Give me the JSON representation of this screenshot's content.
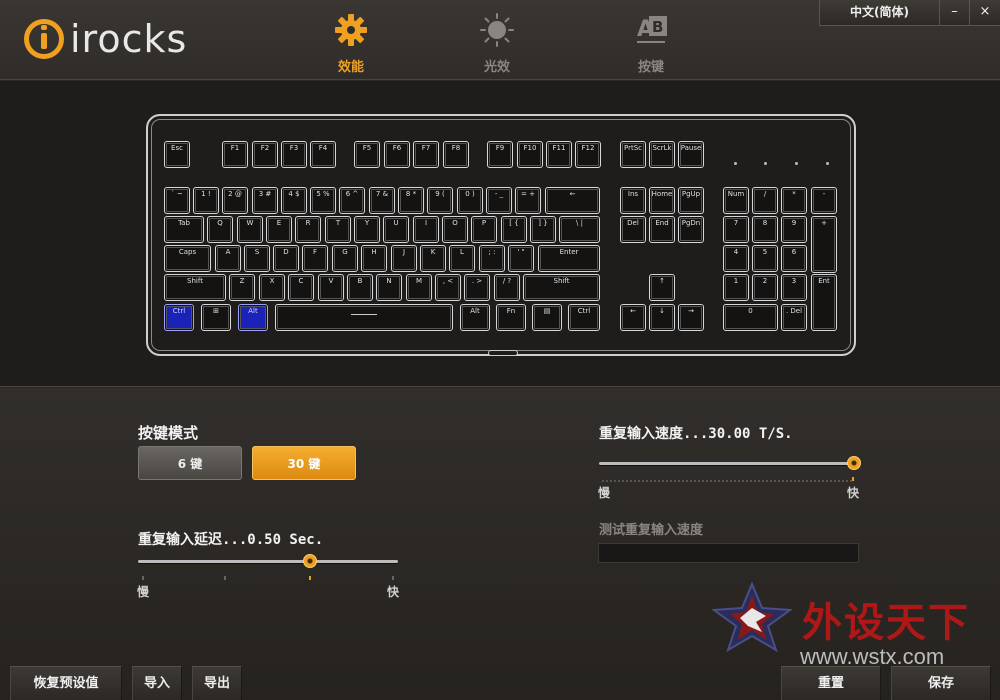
{
  "header": {
    "logo_text": "irocks",
    "tabs": [
      {
        "label": "效能",
        "icon": "gear-icon",
        "active": true
      },
      {
        "label": "光效",
        "icon": "sun-icon",
        "active": false
      },
      {
        "label": "按键",
        "icon": "key-ab-icon",
        "active": false
      }
    ],
    "language": "中文(简体)",
    "minimize": "–",
    "close": "×"
  },
  "keyboard": {
    "highlight_color": "#1a22b8",
    "keys": {
      "esc": "Esc",
      "f1": "F1",
      "f2": "F2",
      "f3": "F3",
      "f4": "F4",
      "f5": "F5",
      "f6": "F6",
      "f7": "F7",
      "f8": "F8",
      "f9": "F9",
      "f10": "F10",
      "f11": "F11",
      "f12": "F12",
      "prtsc": "PrtSc",
      "scrlk": "ScrLk",
      "pause": "Pause",
      "grave": "` ~",
      "n1": "1 !",
      "n2": "2 @",
      "n3": "3 #",
      "n4": "4 $",
      "n5": "5 %",
      "n6": "6 ^",
      "n7": "7 &",
      "n8": "8 *",
      "n9": "9 (",
      "n0": "0 )",
      "minus": "- _",
      "equal": "= +",
      "backspace": "←",
      "ins": "Ins",
      "home": "Home",
      "pgup": "PgUp",
      "numlock": "Num",
      "kpdiv": "/",
      "kpmul": "*",
      "kpsub": "-",
      "tab": "Tab",
      "q": "Q",
      "w": "W",
      "e": "E",
      "r": "R",
      "t": "T",
      "y": "Y",
      "u": "U",
      "i": "I",
      "o": "O",
      "p": "P",
      "lbr": "[ {",
      "rbr": "] }",
      "bslash": "\\ |",
      "del": "Del",
      "end": "End",
      "pgdn": "PgDn",
      "kp7": "7",
      "kp8": "8",
      "kp9": "9",
      "kpadd": "+",
      "caps": "Caps",
      "a": "A",
      "s": "S",
      "d": "D",
      "f": "F",
      "g": "G",
      "h": "H",
      "j": "J",
      "k": "K",
      "l": "L",
      "semi": "; :",
      "quote": "' \"",
      "enter": "Enter",
      "kp4": "4",
      "kp5": "5",
      "kp6": "6",
      "lshift": "Shift",
      "z": "Z",
      "x": "X",
      "c": "C",
      "v": "V",
      "b": "B",
      "n": "N",
      "m": "M",
      "comma": ", <",
      "period": ". >",
      "slash": "/ ?",
      "rshift": "Shift",
      "up": "↑",
      "kp1": "1",
      "kp2": "2",
      "kp3": "3",
      "kpenter": "Ent",
      "lctrl": "Ctrl",
      "win": "⊞",
      "lalt": "Alt",
      "ralt": "Alt",
      "fn": "Fn",
      "menu": "▤",
      "rctrl": "Ctrl",
      "left": "←",
      "down": "↓",
      "right": "→",
      "kp0": "0",
      "kpdot": ". Del"
    }
  },
  "settings": {
    "key_mode": {
      "label": "按键模式",
      "option_6": "6 键",
      "option_30": "30 键",
      "selected": "30 键"
    },
    "repeat_delay": {
      "label": "重复输入延迟...0.50 Sec.",
      "value": 0.5,
      "slow_label": "慢",
      "fast_label": "快"
    },
    "repeat_rate": {
      "label": "重复输入速度...30.00 T/S.",
      "value": 30.0,
      "slow_label": "慢",
      "fast_label": "快"
    },
    "test": {
      "label": "测试重复输入速度",
      "value": ""
    }
  },
  "bottom": {
    "restore_defaults": "恢复预设值",
    "import": "导入",
    "export": "导出",
    "reset": "重置",
    "save": "保存"
  },
  "watermark": {
    "text": "外设天下",
    "url": "www.wstx.com"
  },
  "colors": {
    "accent": "#f0a020",
    "background": "#2b2825"
  }
}
